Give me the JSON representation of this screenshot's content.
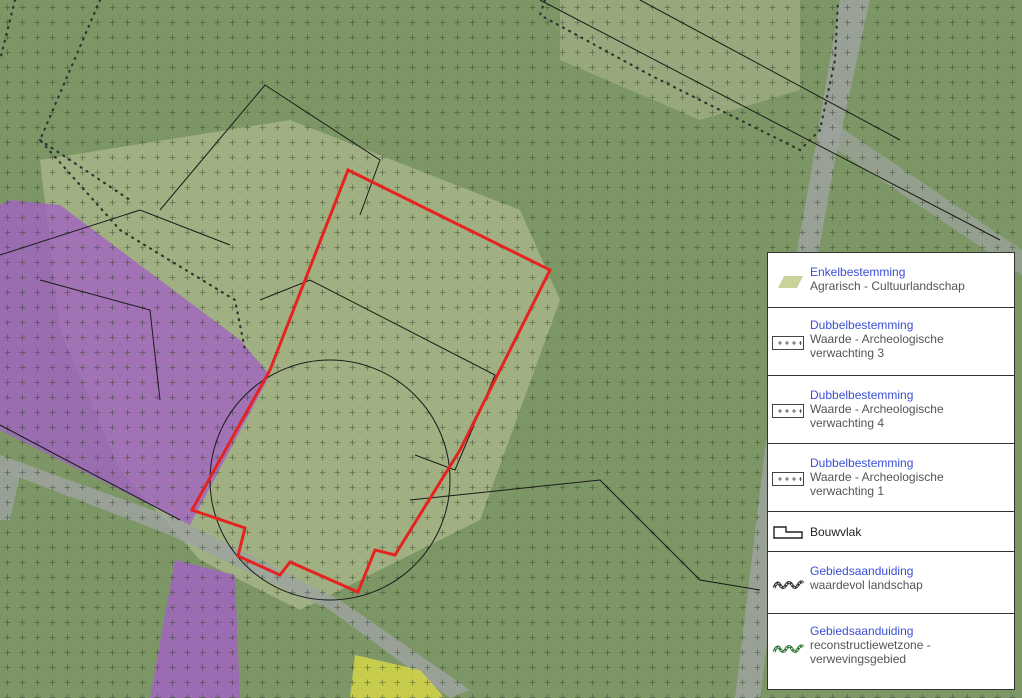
{
  "legend": {
    "items": [
      {
        "title": "Enkelbestemming",
        "sub": "Agrarisch - Cultuurlandschap",
        "icon": "agrarisch-swatch-icon"
      },
      {
        "title": "Dubbelbestemming",
        "sub": "Waarde - Archeologische verwachting 3",
        "icon": "archeologie-hatch-icon"
      },
      {
        "title": "Dubbelbestemming",
        "sub": "Waarde - Archeologische verwachting 4",
        "icon": "archeologie-hatch-icon"
      },
      {
        "title": "Dubbelbestemming",
        "sub": "Waarde - Archeologische verwachting 1",
        "icon": "archeologie-hatch-icon"
      },
      {
        "title": "",
        "sub": "Bouwvlak",
        "icon": "bouwvlak-outline-icon"
      },
      {
        "title": "Gebiedsaanduiding",
        "sub": "waardevol landschap",
        "icon": "waardevol-landschap-icon"
      },
      {
        "title": "Gebiedsaanduiding",
        "sub": "reconstructiewetzone - verwevingsgebied",
        "icon": "reconstructiewetzone-icon"
      }
    ]
  },
  "colors": {
    "field": "#7d9665",
    "agrarisch": "#c8d39a",
    "gemengd": "#a262c4",
    "groen_yellow": "#cfd24a",
    "plan_boundary": "#e52320",
    "road": "#9ea3a0",
    "title_blue": "#3b4fd6"
  }
}
